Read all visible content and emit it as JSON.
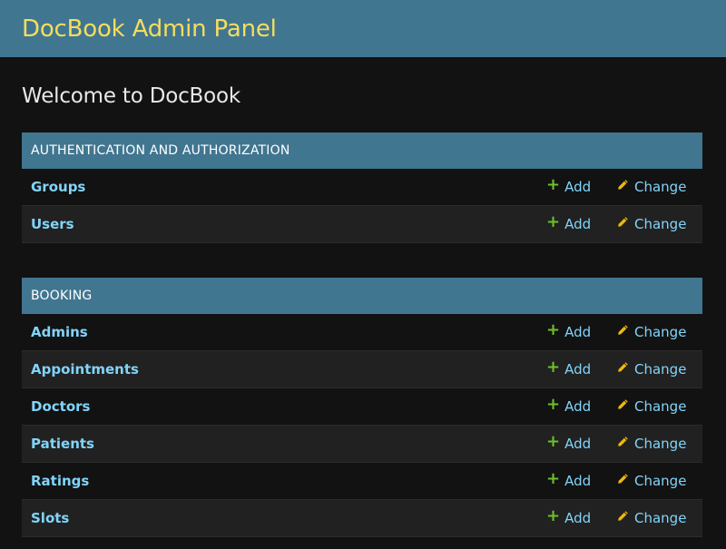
{
  "header": {
    "site_name": "DocBook Admin Panel"
  },
  "page": {
    "title": "Welcome to DocBook"
  },
  "colors": {
    "header_bg": "#417690",
    "site_name": "#f5dd5d",
    "link": "#81d4fa",
    "add_icon": "#70bf2b",
    "change_icon": "#efb80b"
  },
  "modules": [
    {
      "caption": "AUTHENTICATION AND AUTHORIZATION",
      "models": [
        {
          "name": "Groups",
          "add": "Add",
          "change": "Change"
        },
        {
          "name": "Users",
          "add": "Add",
          "change": "Change"
        }
      ]
    },
    {
      "caption": "BOOKING",
      "models": [
        {
          "name": "Admins",
          "add": "Add",
          "change": "Change"
        },
        {
          "name": "Appointments",
          "add": "Add",
          "change": "Change"
        },
        {
          "name": "Doctors",
          "add": "Add",
          "change": "Change"
        },
        {
          "name": "Patients",
          "add": "Add",
          "change": "Change"
        },
        {
          "name": "Ratings",
          "add": "Add",
          "change": "Change"
        },
        {
          "name": "Slots",
          "add": "Add",
          "change": "Change"
        }
      ]
    }
  ]
}
